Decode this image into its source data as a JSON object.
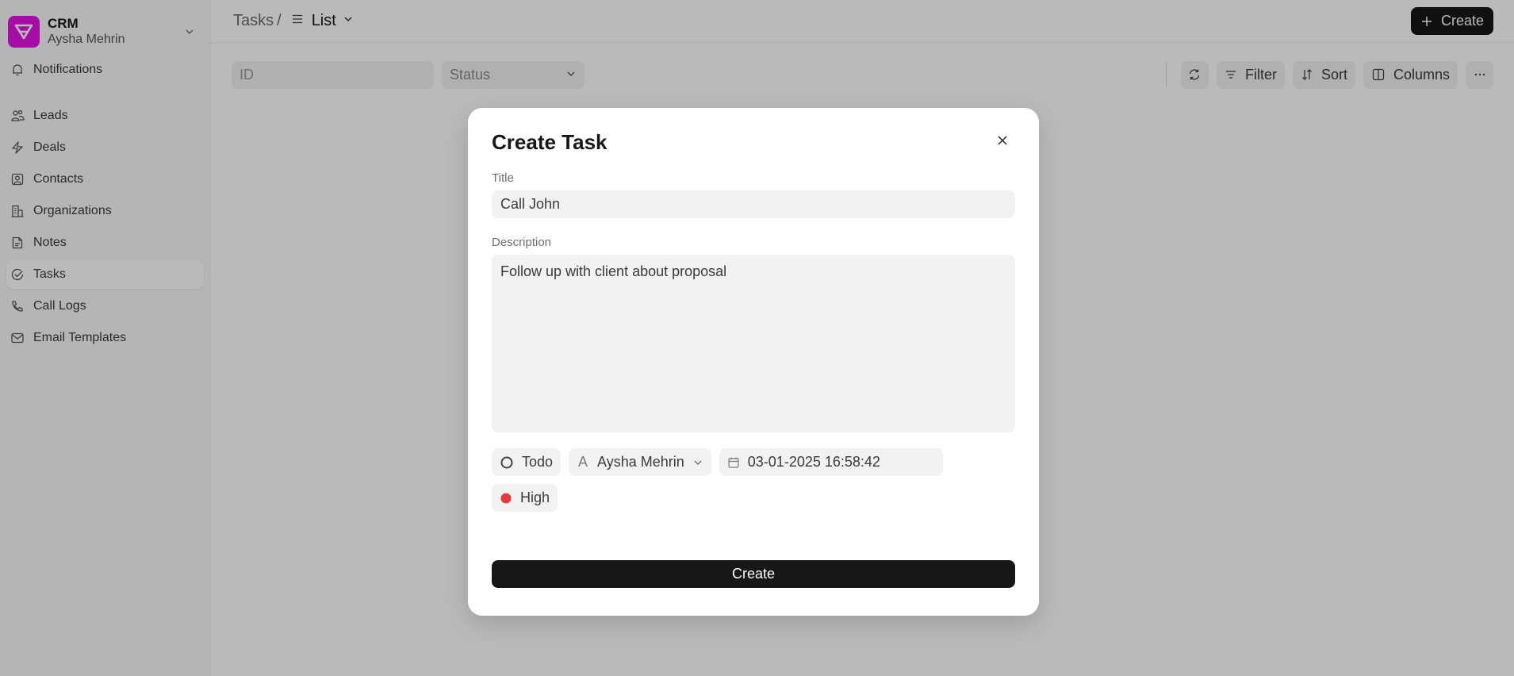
{
  "sidebar": {
    "brand_name": "CRM",
    "user_name": "Aysha Mehrin",
    "brand_color": "#e213e4",
    "items": [
      {
        "label": "Notifications",
        "icon": "bell-icon"
      },
      {
        "label": "Leads",
        "icon": "users-icon"
      },
      {
        "label": "Deals",
        "icon": "lightning-icon"
      },
      {
        "label": "Contacts",
        "icon": "contact-card-icon"
      },
      {
        "label": "Organizations",
        "icon": "building-icon"
      },
      {
        "label": "Notes",
        "icon": "note-icon"
      },
      {
        "label": "Tasks",
        "icon": "check-circle-icon",
        "active": true
      },
      {
        "label": "Call Logs",
        "icon": "phone-icon"
      },
      {
        "label": "Email Templates",
        "icon": "mail-icon"
      }
    ]
  },
  "header": {
    "breadcrumb_root": "Tasks",
    "breadcrumb_sep": "/",
    "view_label": "List",
    "create_label": "Create"
  },
  "filters": {
    "id_placeholder": "ID",
    "status_placeholder": "Status",
    "filter_label": "Filter",
    "sort_label": "Sort",
    "columns_label": "Columns"
  },
  "modal": {
    "title": "Create Task",
    "title_label": "Title",
    "title_value": "Call John",
    "description_label": "Description",
    "description_value": "Follow up with client about proposal",
    "status": "Todo",
    "assignee": "Aysha Mehrin",
    "assignee_initial": "A",
    "due_date": "03-01-2025 16:58:42",
    "priority": "High",
    "priority_color": "#e03e3e",
    "submit_label": "Create"
  }
}
